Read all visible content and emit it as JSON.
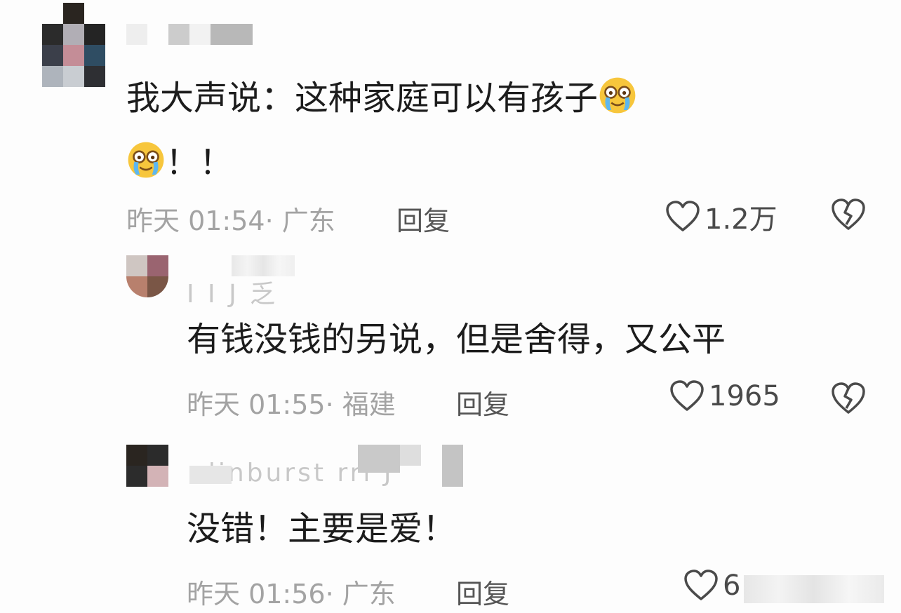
{
  "comments": [
    {
      "text_line1": "我大声说：这种家庭可以有孩子",
      "text_line2": "！！",
      "time": "昨天 01:54",
      "location": "· 广东",
      "reply_label": "回复",
      "likes": "1.2万",
      "emoji": "crying-laughing-emoji"
    },
    {
      "text": "有钱没钱的另说，但是舍得，又公平",
      "time": "昨天 01:55",
      "location": "· 福建",
      "reply_label": "回复",
      "likes": "1965"
    },
    {
      "text": "没错！主要是爱！",
      "time": "昨天 01:56",
      "location": "· 广东",
      "reply_label": "回复",
      "likes": "6"
    }
  ],
  "colors": {
    "text": "#1c1c1c",
    "meta": "#a3a3a3",
    "reply": "#555555",
    "icon": "#4a4a4a",
    "background": "#fdfdfd"
  }
}
